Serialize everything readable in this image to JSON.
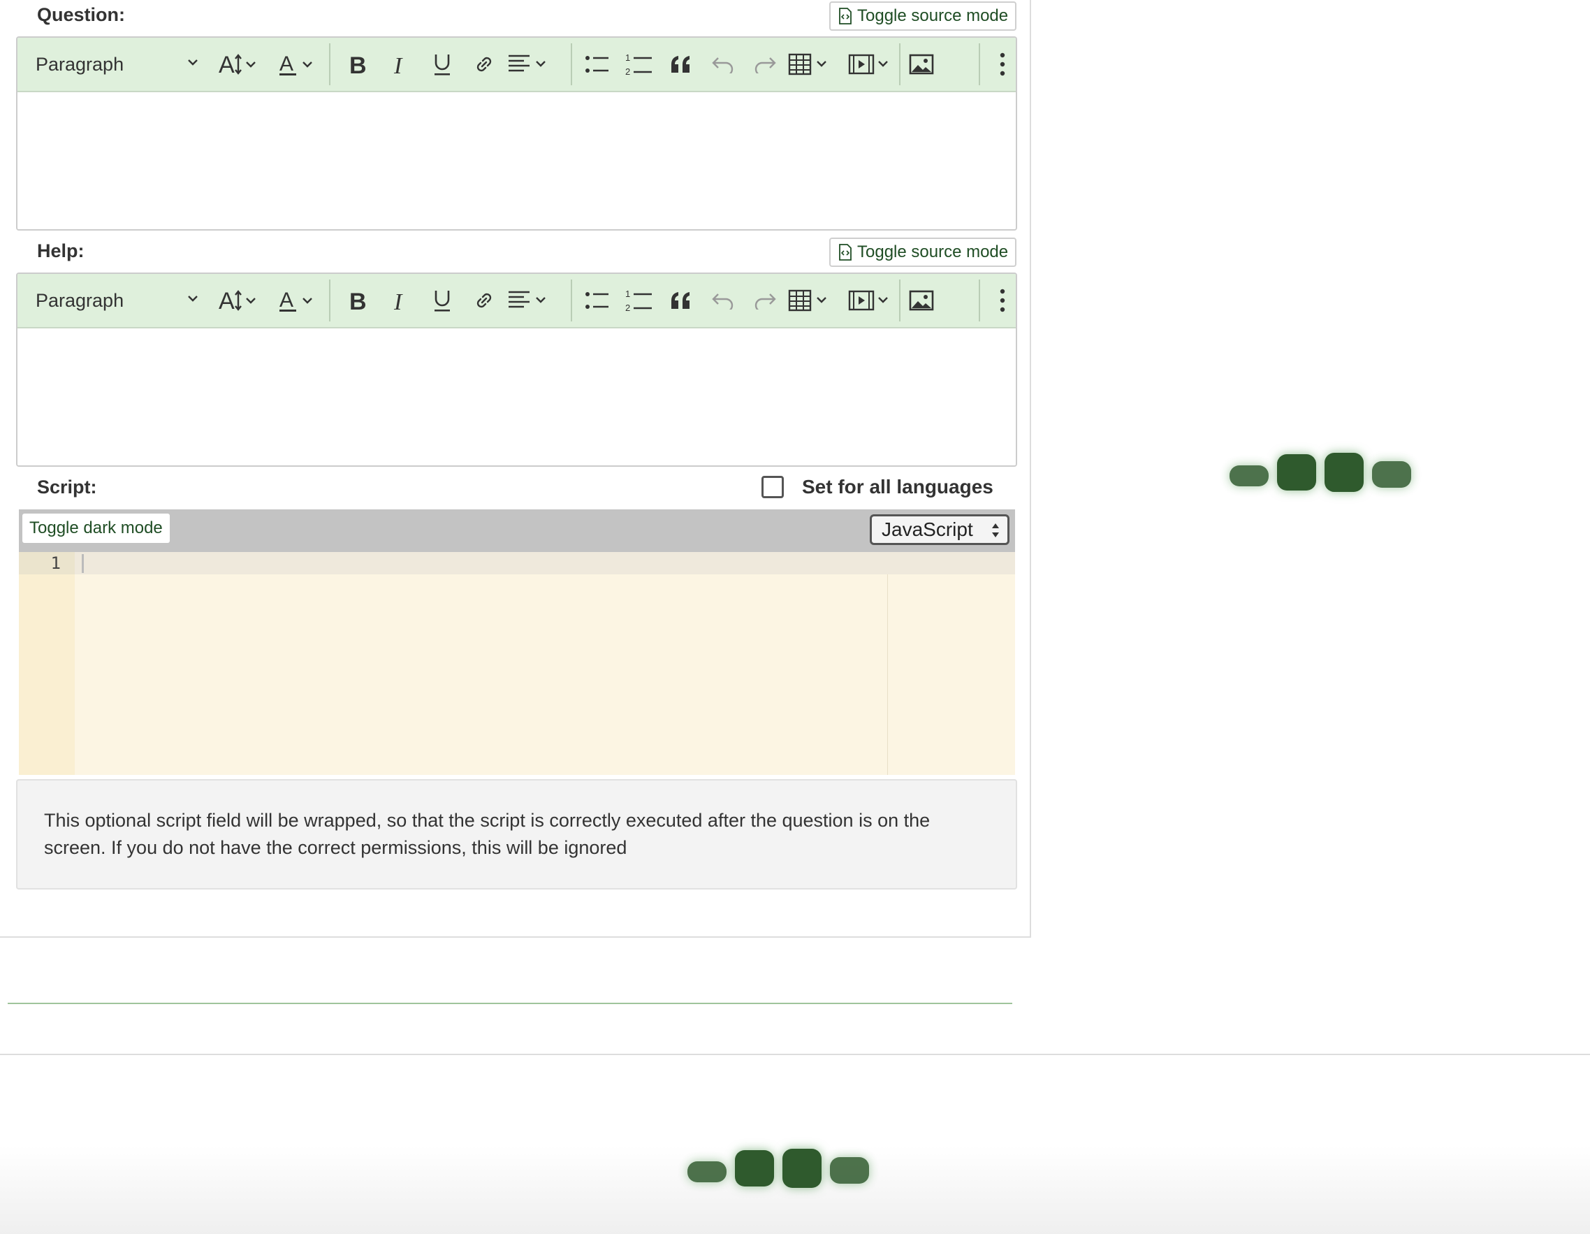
{
  "question": {
    "label": "Question:",
    "toggle_source": "Toggle source mode",
    "toolbar": {
      "paragraph": "Paragraph",
      "icons": [
        "font-size-icon",
        "font-color-icon",
        "bold-icon",
        "italic-icon",
        "underline-icon",
        "link-icon",
        "align-icon",
        "bullet-list-icon",
        "numbered-list-icon",
        "blockquote-icon",
        "undo-icon",
        "redo-icon",
        "table-icon",
        "media-icon",
        "image-icon",
        "more-icon"
      ]
    }
  },
  "help": {
    "label": "Help:",
    "toggle_source": "Toggle source mode",
    "toolbar": {
      "paragraph": "Paragraph"
    }
  },
  "script": {
    "label": "Script:",
    "set_all_languages": "Set for all languages",
    "set_all_checked": false,
    "toggle_dark_mode": "Toggle dark mode",
    "language": "JavaScript",
    "line_numbers": [
      "1"
    ],
    "help_text": "This optional script field will be wrapped, so that the script is correctly executed after the question is on the screen. If you do not have the correct permissions, this will be ignored"
  },
  "colors": {
    "toolbar_bg": "#dff0dc",
    "accent_text": "#1f4d24",
    "loader": "#2f5a2d",
    "code_bg": "#fcf5e3"
  }
}
